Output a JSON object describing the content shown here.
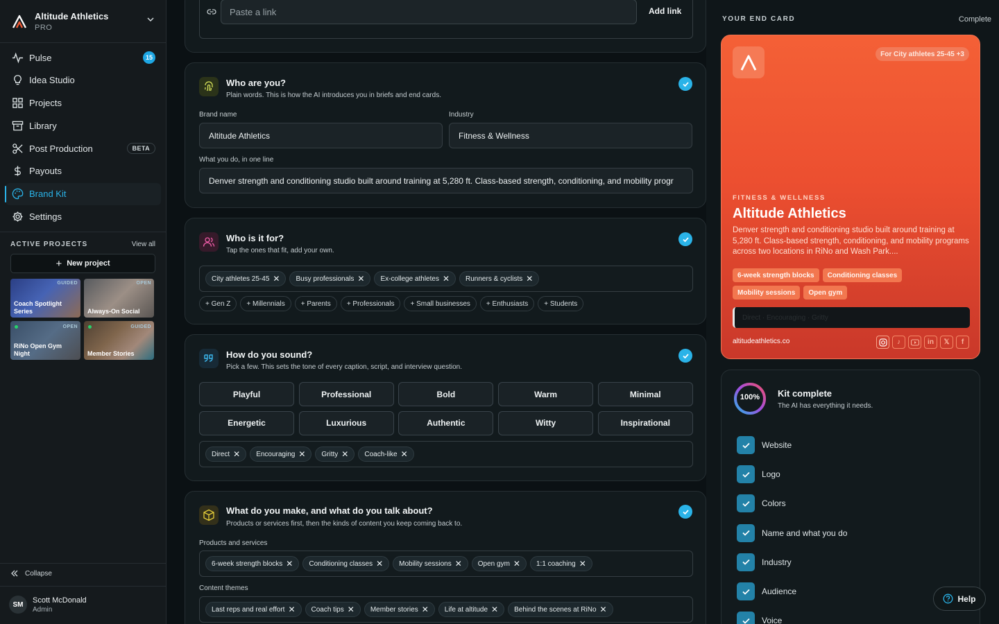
{
  "workspace": {
    "name": "Altitude Athletics",
    "plan": "PRO"
  },
  "nav": [
    {
      "label": "Pulse",
      "icon": "pulse-icon",
      "badge": "15"
    },
    {
      "label": "Idea Studio",
      "icon": "lightbulb-icon"
    },
    {
      "label": "Projects",
      "icon": "grid-icon"
    },
    {
      "label": "Library",
      "icon": "archive-icon"
    },
    {
      "label": "Post Production",
      "icon": "scissors-icon",
      "badge": "BETA"
    },
    {
      "label": "Payouts",
      "icon": "dollar-icon"
    },
    {
      "label": "Brand Kit",
      "icon": "palette-icon",
      "active": true
    },
    {
      "label": "Settings",
      "icon": "gear-icon"
    }
  ],
  "active_projects": {
    "title": "ACTIVE PROJECTS",
    "view_all": "View all",
    "new_label": "New project",
    "items": [
      {
        "label": "Coach Spotlight Series",
        "tag": "GUIDED"
      },
      {
        "label": "Always-On Social",
        "tag": "OPEN"
      },
      {
        "label": "RiNo Open Gym Night",
        "tag": "OPEN"
      },
      {
        "label": "Member Stories",
        "tag": "GUIDED"
      }
    ]
  },
  "collapse_label": "Collapse",
  "user": {
    "initials": "SM",
    "name": "Scott McDonald",
    "role": "Admin"
  },
  "link_section": {
    "placeholder": "Paste a link",
    "button": "Add link"
  },
  "who_are_you": {
    "title": "Who are you?",
    "subtitle": "Plain words. This is how the AI introduces you in briefs and end cards.",
    "brand_label": "Brand name",
    "brand_value": "Altitude Athletics",
    "industry_label": "Industry",
    "industry_value": "Fitness & Wellness",
    "oneline_label": "What you do, in one line",
    "oneline_value": "Denver strength and conditioning studio built around training at 5,280 ft. Class-based strength, conditioning, and mobility progr"
  },
  "who_for": {
    "title": "Who is it for?",
    "subtitle": "Tap the ones that fit, add your own.",
    "selected": [
      "City athletes 25-45",
      "Busy professionals",
      "Ex-college athletes",
      "Runners & cyclists"
    ],
    "suggestions": [
      "+ Gen Z",
      "+ Millennials",
      "+ Parents",
      "+ Professionals",
      "+ Small businesses",
      "+ Enthusiasts",
      "+ Students"
    ]
  },
  "how_sound": {
    "title": "How do you sound?",
    "subtitle": "Pick a few. This sets the tone of every caption, script, and interview question.",
    "tones": [
      "Playful",
      "Professional",
      "Bold",
      "Warm",
      "Minimal",
      "Energetic",
      "Luxurious",
      "Authentic",
      "Witty",
      "Inspirational"
    ],
    "selected": [
      "Direct",
      "Encouraging",
      "Gritty",
      "Coach-like"
    ]
  },
  "what_make": {
    "title": "What do you make, and what do you talk about?",
    "subtitle": "Products or services first, then the kinds of content you keep coming back to.",
    "products_label": "Products and services",
    "products": [
      "6-week strength blocks",
      "Conditioning classes",
      "Mobility sessions",
      "Open gym",
      "1:1 coaching"
    ],
    "themes_label": "Content themes",
    "themes": [
      "Last reps and real effort",
      "Coach tips",
      "Member stories",
      "Life at altitude",
      "Behind the scenes at RiNo"
    ]
  },
  "end_card": {
    "title": "YOUR END CARD",
    "status": "Complete",
    "audience_badge": "For City athletes 25-45 +3",
    "industry": "FITNESS & WELLNESS",
    "name": "Altitude Athletics",
    "description": "Denver strength and conditioning studio built around training at 5,280 ft. Class-based strength, conditioning, and mobility programs across two locations in RiNo and Wash Park....",
    "chips": [
      "6-week strength blocks",
      "Conditioning classes",
      "Mobility sessions",
      "Open gym"
    ],
    "voice": "Direct · Encouraging · Gritty",
    "website": "altitudeathletics.co",
    "socials": [
      "instagram-icon",
      "tiktok-icon",
      "youtube-icon",
      "linkedin-icon",
      "x-icon",
      "facebook-icon"
    ]
  },
  "kit": {
    "percent": "100%",
    "progress": 1.0,
    "title": "Kit complete",
    "subtitle": "The AI has everything it needs.",
    "items": [
      "Website",
      "Logo",
      "Colors",
      "Name and what you do",
      "Industry",
      "Audience",
      "Voice"
    ]
  },
  "help_label": "Help",
  "colors": {
    "accent": "#2ab3e8",
    "end_card": "#f05a34"
  }
}
